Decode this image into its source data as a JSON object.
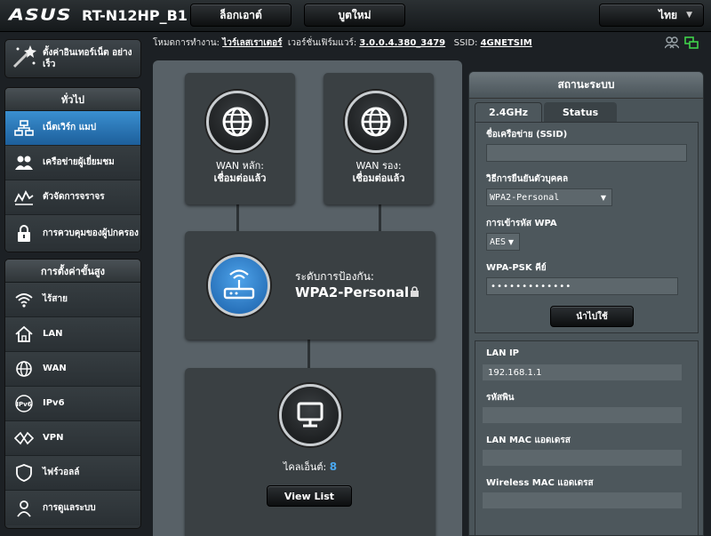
{
  "topbar": {
    "brand": "ASUS",
    "model": "RT-N12HP_B1",
    "logout_label": "ล็อกเอาต์",
    "reboot_label": "บูตใหม่",
    "language": "ไทย"
  },
  "status_line": {
    "mode_label": "โหมดการทำงาน:",
    "mode_value": "ไวร์เลสเราเตอร์",
    "firmware_label": "เวอร์ชั่นเฟิร์มแวร์:",
    "firmware_value": "3.0.0.4.380_3479",
    "ssid_label": "SSID:",
    "ssid_value": "4GNETSIM"
  },
  "sidebar": {
    "qis_label": "ตั้งค่าอินเทอร์เน็ต อย่างเร็ว",
    "general_header": "ทั่วไป",
    "general_items": [
      {
        "label": "เน็ตเวิร์ก แมป",
        "icon": "network-map-icon"
      },
      {
        "label": "เครือข่ายผู้เยี่ยมชม",
        "icon": "guest-network-icon"
      },
      {
        "label": "ตัวจัดการจราจร",
        "icon": "traffic-manager-icon"
      },
      {
        "label": "การควบคุมของผู้ปกครอง",
        "icon": "parental-lock-icon"
      }
    ],
    "advanced_header": "การตั้งค่าขั้นสูง",
    "advanced_items": [
      {
        "label": "ไร้สาย",
        "icon": "wireless-icon"
      },
      {
        "label": "LAN",
        "icon": "home-icon"
      },
      {
        "label": "WAN",
        "icon": "globe-icon"
      },
      {
        "label": "IPv6",
        "icon": "ipv6-icon"
      },
      {
        "label": "VPN",
        "icon": "vpn-icon"
      },
      {
        "label": "ไฟร์วอลล์",
        "icon": "shield-icon"
      },
      {
        "label": "การดูแลระบบ",
        "icon": "admin-user-icon"
      }
    ]
  },
  "map": {
    "wan_primary": "WAN หลัก:",
    "wan_primary_status": "เชื่อมต่อแล้ว",
    "wan_secondary": "WAN รอง:",
    "wan_secondary_status": "เชื่อมต่อแล้ว",
    "security_label": "ระดับการป้องกัน:",
    "security_value": "WPA2-Personal",
    "clients_label": "ไคลเอ็นต์:",
    "clients_count": "8",
    "view_list": "View List"
  },
  "system_status": {
    "title": "สถานะระบบ",
    "tab_band": "2.4GHz",
    "tab_status": "Status",
    "ssid_label": "ชื่อเครือข่าย (SSID)",
    "ssid_value": "",
    "auth_label": "วิธีการยืนยันตัวบุคคล",
    "auth_value": "WPA2-Personal",
    "encryption_label": "การเข้ารหัส WPA",
    "encryption_value": "AES",
    "psk_label": "WPA-PSK คีย์",
    "psk_value": "•••••••••••••",
    "apply_label": "นำไปใช้",
    "lan_ip_label": "LAN IP",
    "lan_ip_value": "192.168.1.1",
    "pin_label": "รหัสพิน",
    "pin_value": "",
    "lan_mac_label": "LAN MAC แอดเดรส",
    "lan_mac_value": "",
    "wireless_mac_label": "Wireless MAC แอดเดรส",
    "wireless_mac_value": ""
  },
  "colors": {
    "accent_blue": "#2f7fc4",
    "panel": "#586167",
    "status_link_green": "#3fd24a"
  }
}
